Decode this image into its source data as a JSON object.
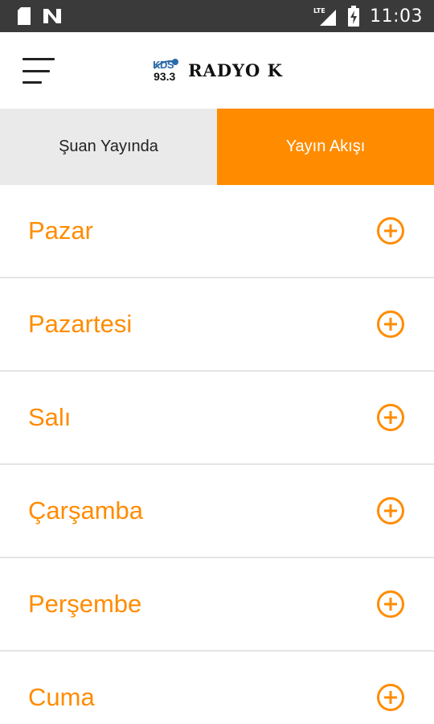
{
  "status_bar": {
    "time": "11:03",
    "network": "LTE",
    "icons": [
      "sd-card-icon",
      "notification-n-icon",
      "signal-icon",
      "battery-charging-icon"
    ]
  },
  "app_bar": {
    "logo_small": "KDS",
    "logo_frequency": "93.3",
    "logo_name": "RADYO K"
  },
  "tabs": [
    {
      "label": "Şuan Yayında",
      "active": false
    },
    {
      "label": "Yayın Akışı",
      "active": true
    }
  ],
  "days": [
    {
      "label": "Pazar"
    },
    {
      "label": "Pazartesi"
    },
    {
      "label": "Salı"
    },
    {
      "label": "Çarşamba"
    },
    {
      "label": "Perşembe"
    },
    {
      "label": "Cuma"
    }
  ],
  "colors": {
    "accent": "#ff8c00",
    "status_bar": "#3a3a3a",
    "tab_inactive": "#ebeaea",
    "divider": "#e4e4e4"
  }
}
